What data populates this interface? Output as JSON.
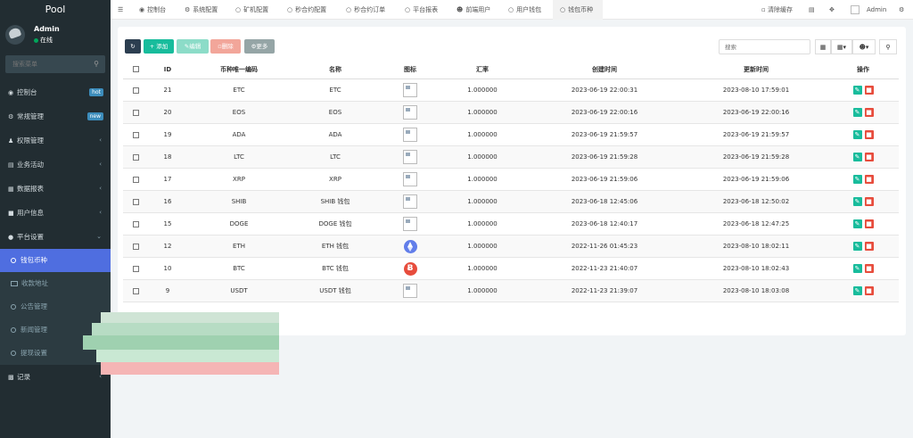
{
  "app": {
    "logo": "Pool"
  },
  "user": {
    "name": "Admin",
    "status": "在线"
  },
  "sidebar": {
    "search_placeholder": "搜索菜单",
    "items": [
      {
        "label": "控制台",
        "icon": "dashboard-icon",
        "badge": "hot"
      },
      {
        "label": "常规管理",
        "icon": "cogs-icon",
        "badge": "new"
      },
      {
        "label": "权限管理",
        "icon": "group-icon"
      },
      {
        "label": "业务活动",
        "icon": "list-icon"
      },
      {
        "label": "数据报表",
        "icon": "report-icon"
      },
      {
        "label": "用户信息",
        "icon": "user-icon"
      },
      {
        "label": "平台设置",
        "icon": "gear-icon"
      }
    ],
    "submenu": [
      {
        "label": "钱包币种",
        "active": true
      },
      {
        "label": "收款地址"
      },
      {
        "label": "公告管理"
      },
      {
        "label": "新闻管理"
      },
      {
        "label": "提现设置"
      }
    ],
    "last_item": {
      "label": "记录",
      "icon": "chart-icon"
    }
  },
  "topnav": {
    "tabs": [
      {
        "label": "控制台",
        "icon": "dashboard-icon"
      },
      {
        "label": "系统配置",
        "icon": "cog-icon"
      },
      {
        "label": "矿机配置",
        "icon": "circle-icon"
      },
      {
        "label": "秒合约配置",
        "icon": "circle-icon"
      },
      {
        "label": "秒合约订单",
        "icon": "circle-icon"
      },
      {
        "label": "平台报表",
        "icon": "circle-icon"
      },
      {
        "label": "前端用户",
        "icon": "user-icon"
      },
      {
        "label": "用户钱包",
        "icon": "circle-icon"
      },
      {
        "label": "钱包币种",
        "icon": "circle-icon",
        "active": true
      }
    ],
    "clear_cache": "清除缓存",
    "admin": "Admin"
  },
  "toolbar": {
    "add": "添加",
    "edit": "编辑",
    "delete": "删除",
    "more": "更多",
    "search_placeholder": "搜索"
  },
  "table": {
    "headers": [
      "ID",
      "币种唯一编码",
      "名称",
      "图标",
      "汇率",
      "创建时间",
      "更新时间",
      "操作"
    ],
    "rows": [
      {
        "id": "21",
        "code": "ETC",
        "name": "ETC",
        "icon": "broken",
        "rate": "1.000000",
        "created": "2023-06-19 22:00:31",
        "updated": "2023-08-10 17:59:01"
      },
      {
        "id": "20",
        "code": "EOS",
        "name": "EOS",
        "icon": "broken",
        "rate": "1.000000",
        "created": "2023-06-19 22:00:16",
        "updated": "2023-06-19 22:00:16"
      },
      {
        "id": "19",
        "code": "ADA",
        "name": "ADA",
        "icon": "broken",
        "rate": "1.000000",
        "created": "2023-06-19 21:59:57",
        "updated": "2023-06-19 21:59:57"
      },
      {
        "id": "18",
        "code": "LTC",
        "name": "LTC",
        "icon": "broken",
        "rate": "1.000000",
        "created": "2023-06-19 21:59:28",
        "updated": "2023-06-19 21:59:28"
      },
      {
        "id": "17",
        "code": "XRP",
        "name": "XRP",
        "icon": "broken",
        "rate": "1.000000",
        "created": "2023-06-19 21:59:06",
        "updated": "2023-06-19 21:59:06"
      },
      {
        "id": "16",
        "code": "SHIB",
        "name": "SHIB 钱包",
        "icon": "broken",
        "rate": "1.000000",
        "created": "2023-06-18 12:45:06",
        "updated": "2023-06-18 12:50:02"
      },
      {
        "id": "15",
        "code": "DOGE",
        "name": "DOGE 钱包",
        "icon": "broken",
        "rate": "1.000000",
        "created": "2023-06-18 12:40:17",
        "updated": "2023-06-18 12:47:25"
      },
      {
        "id": "12",
        "code": "ETH",
        "name": "ETH 钱包",
        "icon": "eth",
        "rate": "1.000000",
        "created": "2022-11-26 01:45:23",
        "updated": "2023-08-10 18:02:11"
      },
      {
        "id": "10",
        "code": "BTC",
        "name": "BTC 钱包",
        "icon": "btc",
        "rate": "1.000000",
        "created": "2022-11-23 21:40:07",
        "updated": "2023-08-10 18:02:43"
      },
      {
        "id": "9",
        "code": "USDT",
        "name": "USDT 钱包",
        "icon": "broken",
        "rate": "1.000000",
        "created": "2022-11-23 21:39:07",
        "updated": "2023-08-10 18:03:08"
      }
    ]
  },
  "colors": {
    "sidebar": "#222d32",
    "active": "#4f6ee0",
    "success": "#18bc9c",
    "danger": "#e74c3c"
  }
}
